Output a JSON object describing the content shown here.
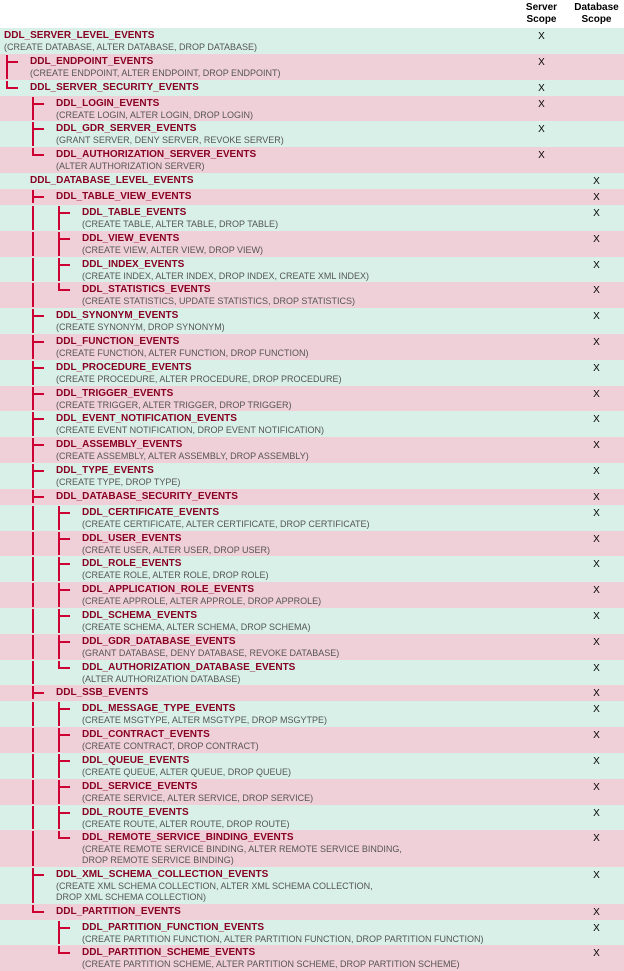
{
  "headers": {
    "server": "Server Scope",
    "database": "Database Scope"
  },
  "rows": [
    {
      "indent": 0,
      "conn": [],
      "title": "DDL_SERVER_LEVEL_EVENTS",
      "detail": "(CREATE DATABASE, ALTER DATABASE, DROP DATABASE)",
      "server": "X",
      "database": "",
      "stripe": "mint"
    },
    {
      "indent": 1,
      "conn": [
        "tick"
      ],
      "title": "DDL_ENDPOINT_EVENTS",
      "detail": "(CREATE ENDPOINT, ALTER ENDPOINT, DROP ENDPOINT)",
      "server": "X",
      "database": "",
      "stripe": "pink"
    },
    {
      "indent": 1,
      "conn": [
        "last"
      ],
      "title": "DDL_SERVER_SECURITY_EVENTS",
      "detail": "",
      "server": "X",
      "database": "",
      "stripe": "mint"
    },
    {
      "indent": 2,
      "conn": [
        "none",
        "tick"
      ],
      "title": "DDL_LOGIN_EVENTS",
      "detail": "(CREATE LOGIN, ALTER LOGIN, DROP LOGIN)",
      "server": "X",
      "database": "",
      "stripe": "pink"
    },
    {
      "indent": 2,
      "conn": [
        "none",
        "tick"
      ],
      "title": "DDL_GDR_SERVER_EVENTS",
      "detail": "(GRANT SERVER, DENY SERVER, REVOKE SERVER)",
      "server": "X",
      "database": "",
      "stripe": "mint"
    },
    {
      "indent": 2,
      "conn": [
        "none",
        "last"
      ],
      "title": "DDL_AUTHORIZATION_SERVER_EVENTS",
      "detail": "(ALTER AUTHORIZATION SERVER)",
      "server": "X",
      "database": "",
      "stripe": "pink"
    },
    {
      "indent": 1,
      "conn": [
        "none"
      ],
      "title": "DDL_DATABASE_LEVEL_EVENTS",
      "detail": "",
      "server": "",
      "database": "X",
      "stripe": "mint"
    },
    {
      "indent": 2,
      "conn": [
        "none",
        "tick"
      ],
      "title": "DDL_TABLE_VIEW_EVENTS",
      "detail": "",
      "server": "",
      "database": "X",
      "stripe": "pink"
    },
    {
      "indent": 3,
      "conn": [
        "none",
        "pass",
        "tick"
      ],
      "title": "DDL_TABLE_EVENTS",
      "detail": "(CREATE TABLE, ALTER TABLE, DROP TABLE)",
      "server": "",
      "database": "X",
      "stripe": "mint"
    },
    {
      "indent": 3,
      "conn": [
        "none",
        "pass",
        "tick"
      ],
      "title": "DDL_VIEW_EVENTS",
      "detail": "(CREATE VIEW, ALTER VIEW, DROP VIEW)",
      "server": "",
      "database": "X",
      "stripe": "pink"
    },
    {
      "indent": 3,
      "conn": [
        "none",
        "pass",
        "tick"
      ],
      "title": "DDL_INDEX_EVENTS",
      "detail": "(CREATE INDEX, ALTER INDEX, DROP INDEX, CREATE XML INDEX)",
      "server": "",
      "database": "X",
      "stripe": "mint"
    },
    {
      "indent": 3,
      "conn": [
        "none",
        "pass",
        "last"
      ],
      "title": "DDL_STATISTICS_EVENTS",
      "detail": "(CREATE STATISTICS, UPDATE STATISTICS, DROP STATISTICS)",
      "server": "",
      "database": "X",
      "stripe": "pink"
    },
    {
      "indent": 2,
      "conn": [
        "none",
        "tick"
      ],
      "title": "DDL_SYNONYM_EVENTS",
      "detail": "(CREATE SYNONYM, DROP SYNONYM)",
      "server": "",
      "database": "X",
      "stripe": "mint"
    },
    {
      "indent": 2,
      "conn": [
        "none",
        "tick"
      ],
      "title": "DDL_FUNCTION_EVENTS",
      "detail": "(CREATE FUNCTION, ALTER FUNCTION, DROP FUNCTION)",
      "server": "",
      "database": "X",
      "stripe": "pink"
    },
    {
      "indent": 2,
      "conn": [
        "none",
        "tick"
      ],
      "title": "DDL_PROCEDURE_EVENTS",
      "detail": "(CREATE PROCEDURE, ALTER PROCEDURE, DROP PROCEDURE)",
      "server": "",
      "database": "X",
      "stripe": "mint"
    },
    {
      "indent": 2,
      "conn": [
        "none",
        "tick"
      ],
      "title": "DDL_TRIGGER_EVENTS",
      "detail": "(CREATE TRIGGER, ALTER TRIGGER, DROP TRIGGER)",
      "server": "",
      "database": "X",
      "stripe": "pink"
    },
    {
      "indent": 2,
      "conn": [
        "none",
        "tick"
      ],
      "title": "DDL_EVENT_NOTIFICATION_EVENTS",
      "detail": "(CREATE EVENT NOTIFICATION, DROP EVENT NOTIFICATION)",
      "server": "",
      "database": "X",
      "stripe": "mint"
    },
    {
      "indent": 2,
      "conn": [
        "none",
        "tick"
      ],
      "title": "DDL_ASSEMBLY_EVENTS",
      "detail": "(CREATE ASSEMBLY, ALTER ASSEMBLY, DROP ASSEMBLY)",
      "server": "",
      "database": "X",
      "stripe": "pink"
    },
    {
      "indent": 2,
      "conn": [
        "none",
        "tick"
      ],
      "title": "DDL_TYPE_EVENTS",
      "detail": "(CREATE TYPE, DROP TYPE)",
      "server": "",
      "database": "X",
      "stripe": "mint"
    },
    {
      "indent": 2,
      "conn": [
        "none",
        "tick"
      ],
      "title": "DDL_DATABASE_SECURITY_EVENTS",
      "detail": "",
      "server": "",
      "database": "X",
      "stripe": "pink"
    },
    {
      "indent": 3,
      "conn": [
        "none",
        "pass",
        "tick"
      ],
      "title": "DDL_CERTIFICATE_EVENTS",
      "detail": "(CREATE CERTIFICATE, ALTER CERTIFICATE, DROP CERTIFICATE)",
      "server": "",
      "database": "X",
      "stripe": "mint"
    },
    {
      "indent": 3,
      "conn": [
        "none",
        "pass",
        "tick"
      ],
      "title": "DDL_USER_EVENTS",
      "detail": "(CREATE USER, ALTER USER, DROP USER)",
      "server": "",
      "database": "X",
      "stripe": "pink"
    },
    {
      "indent": 3,
      "conn": [
        "none",
        "pass",
        "tick"
      ],
      "title": "DDL_ROLE_EVENTS",
      "detail": "(CREATE ROLE, ALTER ROLE, DROP ROLE)",
      "server": "",
      "database": "X",
      "stripe": "mint"
    },
    {
      "indent": 3,
      "conn": [
        "none",
        "pass",
        "tick"
      ],
      "title": "DDL_APPLICATION_ROLE_EVENTS",
      "detail": "(CREATE APPROLE, ALTER APPROLE, DROP APPROLE)",
      "server": "",
      "database": "X",
      "stripe": "pink"
    },
    {
      "indent": 3,
      "conn": [
        "none",
        "pass",
        "tick"
      ],
      "title": "DDL_SCHEMA_EVENTS",
      "detail": "(CREATE SCHEMA, ALTER SCHEMA, DROP SCHEMA)",
      "server": "",
      "database": "X",
      "stripe": "mint"
    },
    {
      "indent": 3,
      "conn": [
        "none",
        "pass",
        "tick"
      ],
      "title": "DDL_GDR_DATABASE_EVENTS",
      "detail": "(GRANT DATABASE, DENY DATABASE, REVOKE DATABASE)",
      "server": "",
      "database": "X",
      "stripe": "pink"
    },
    {
      "indent": 3,
      "conn": [
        "none",
        "pass",
        "last"
      ],
      "title": "DDL_AUTHORIZATION_DATABASE_EVENTS",
      "detail": "(ALTER AUTHORIZATION DATABASE)",
      "server": "",
      "database": "X",
      "stripe": "mint"
    },
    {
      "indent": 2,
      "conn": [
        "none",
        "tick"
      ],
      "title": "DDL_SSB_EVENTS",
      "detail": "",
      "server": "",
      "database": "X",
      "stripe": "pink"
    },
    {
      "indent": 3,
      "conn": [
        "none",
        "pass",
        "tick"
      ],
      "title": "DDL_MESSAGE_TYPE_EVENTS",
      "detail": "(CREATE MSGTYPE, ALTER MSGTYPE, DROP MSGYTPE)",
      "server": "",
      "database": "X",
      "stripe": "mint"
    },
    {
      "indent": 3,
      "conn": [
        "none",
        "pass",
        "tick"
      ],
      "title": "DDL_CONTRACT_EVENTS",
      "detail": "(CREATE CONTRACT, DROP CONTRACT)",
      "server": "",
      "database": "X",
      "stripe": "pink"
    },
    {
      "indent": 3,
      "conn": [
        "none",
        "pass",
        "tick"
      ],
      "title": "DDL_QUEUE_EVENTS",
      "detail": "(CREATE QUEUE, ALTER QUEUE, DROP QUEUE)",
      "server": "",
      "database": "X",
      "stripe": "mint"
    },
    {
      "indent": 3,
      "conn": [
        "none",
        "pass",
        "tick"
      ],
      "title": "DDL_SERVICE_EVENTS",
      "detail": "(CREATE SERVICE, ALTER SERVICE, DROP SERVICE)",
      "server": "",
      "database": "X",
      "stripe": "pink"
    },
    {
      "indent": 3,
      "conn": [
        "none",
        "pass",
        "tick"
      ],
      "title": "DDL_ROUTE_EVENTS",
      "detail": "(CREATE ROUTE, ALTER ROUTE, DROP ROUTE)",
      "server": "",
      "database": "X",
      "stripe": "mint"
    },
    {
      "indent": 3,
      "conn": [
        "none",
        "pass",
        "last"
      ],
      "title": "DDL_REMOTE_SERVICE_BINDING_EVENTS",
      "detail": "(CREATE REMOTE SERVICE BINDING, ALTER REMOTE SERVICE BINDING,\n DROP REMOTE SERVICE BINDING)",
      "server": "",
      "database": "X",
      "stripe": "pink"
    },
    {
      "indent": 2,
      "conn": [
        "none",
        "tick"
      ],
      "title": "DDL_XML_SCHEMA_COLLECTION_EVENTS",
      "detail": "(CREATE XML SCHEMA COLLECTION, ALTER XML SCHEMA COLLECTION,\n DROP XML SCHEMA COLLECTION)",
      "server": "",
      "database": "X",
      "stripe": "mint"
    },
    {
      "indent": 2,
      "conn": [
        "none",
        "last"
      ],
      "title": "DDL_PARTITION_EVENTS",
      "detail": "",
      "server": "",
      "database": "X",
      "stripe": "pink"
    },
    {
      "indent": 3,
      "conn": [
        "none",
        "none",
        "tick"
      ],
      "title": "DDL_PARTITION_FUNCTION_EVENTS",
      "detail": "(CREATE PARTITION FUNCTION, ALTER PARTITION FUNCTION, DROP PARTITION FUNCTION)",
      "server": "",
      "database": "X",
      "stripe": "mint"
    },
    {
      "indent": 3,
      "conn": [
        "none",
        "none",
        "last"
      ],
      "title": "DDL_PARTITION_SCHEME_EVENTS",
      "detail": "(CREATE PARTITION SCHEME, ALTER PARTITION SCHEME, DROP PARTITION SCHEME)",
      "server": "",
      "database": "X",
      "stripe": "pink"
    }
  ]
}
